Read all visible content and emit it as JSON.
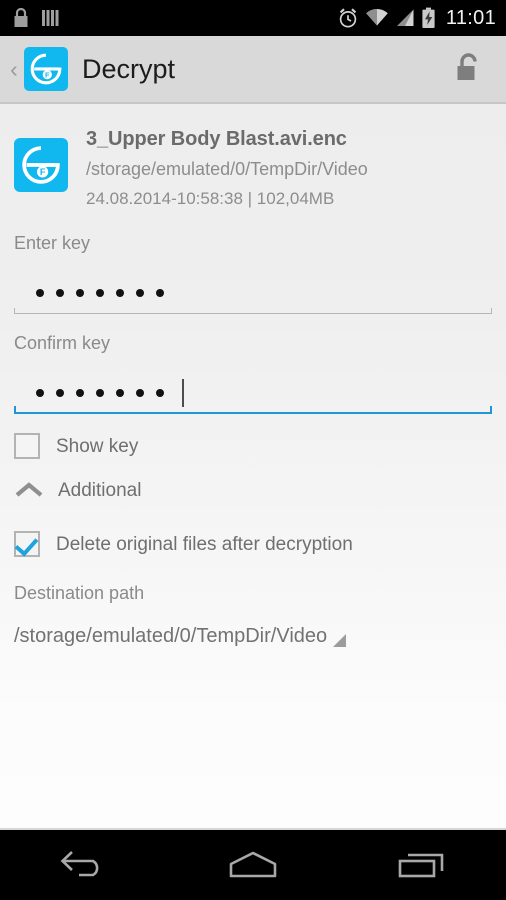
{
  "status_bar": {
    "left_icons": [
      {
        "name": "lock-icon",
        "label": "lock"
      },
      {
        "name": "bars-icon",
        "label": "vertical-bars"
      }
    ],
    "right_icons": [
      {
        "name": "alarm-icon",
        "label": "alarm"
      },
      {
        "name": "wifi-icon",
        "label": "wifi"
      },
      {
        "name": "cellular-signal-icon",
        "label": "cellular"
      },
      {
        "name": "battery-charging-icon",
        "label": "battery-charging"
      }
    ],
    "clock": "11:01"
  },
  "app_bar": {
    "back_chevron": "‹",
    "title": "Decrypt",
    "logo_letter": "F",
    "action_icon": "unlock-icon"
  },
  "file": {
    "name": "3_Upper Body Blast.avi.enc",
    "path": "/storage/emulated/0/TempDir/Video",
    "stats": "24.08.2014-10:58:38 | 102,04MB",
    "icon_letter": "F"
  },
  "form": {
    "enter_key": {
      "label": "Enter key",
      "masked_length": 7,
      "focused": false,
      "has_caret": false
    },
    "confirm_key": {
      "label": "Confirm key",
      "masked_length": 7,
      "focused": true,
      "has_caret": true
    },
    "show_key": {
      "label": "Show key",
      "checked": false
    },
    "additional": {
      "label": "Additional",
      "expanded": true,
      "icon": "chevron-up-icon"
    },
    "delete_originals": {
      "label": "Delete original files after decryption",
      "checked": true
    },
    "destination": {
      "label": "Destination path",
      "value": "/storage/emulated/0/TempDir/Video"
    }
  },
  "nav_bar": {
    "buttons": [
      {
        "name": "nav-back-button",
        "label": "Back"
      },
      {
        "name": "nav-home-button",
        "label": "Home"
      },
      {
        "name": "nav-recents-button",
        "label": "Recents"
      }
    ]
  },
  "colors": {
    "accent": "#10b8ef",
    "focus_underline": "#2196d4",
    "checkbox_check": "#1fa3dd",
    "app_bar_bg": "#d9d9d9",
    "status_bar_bg": "#000000"
  }
}
